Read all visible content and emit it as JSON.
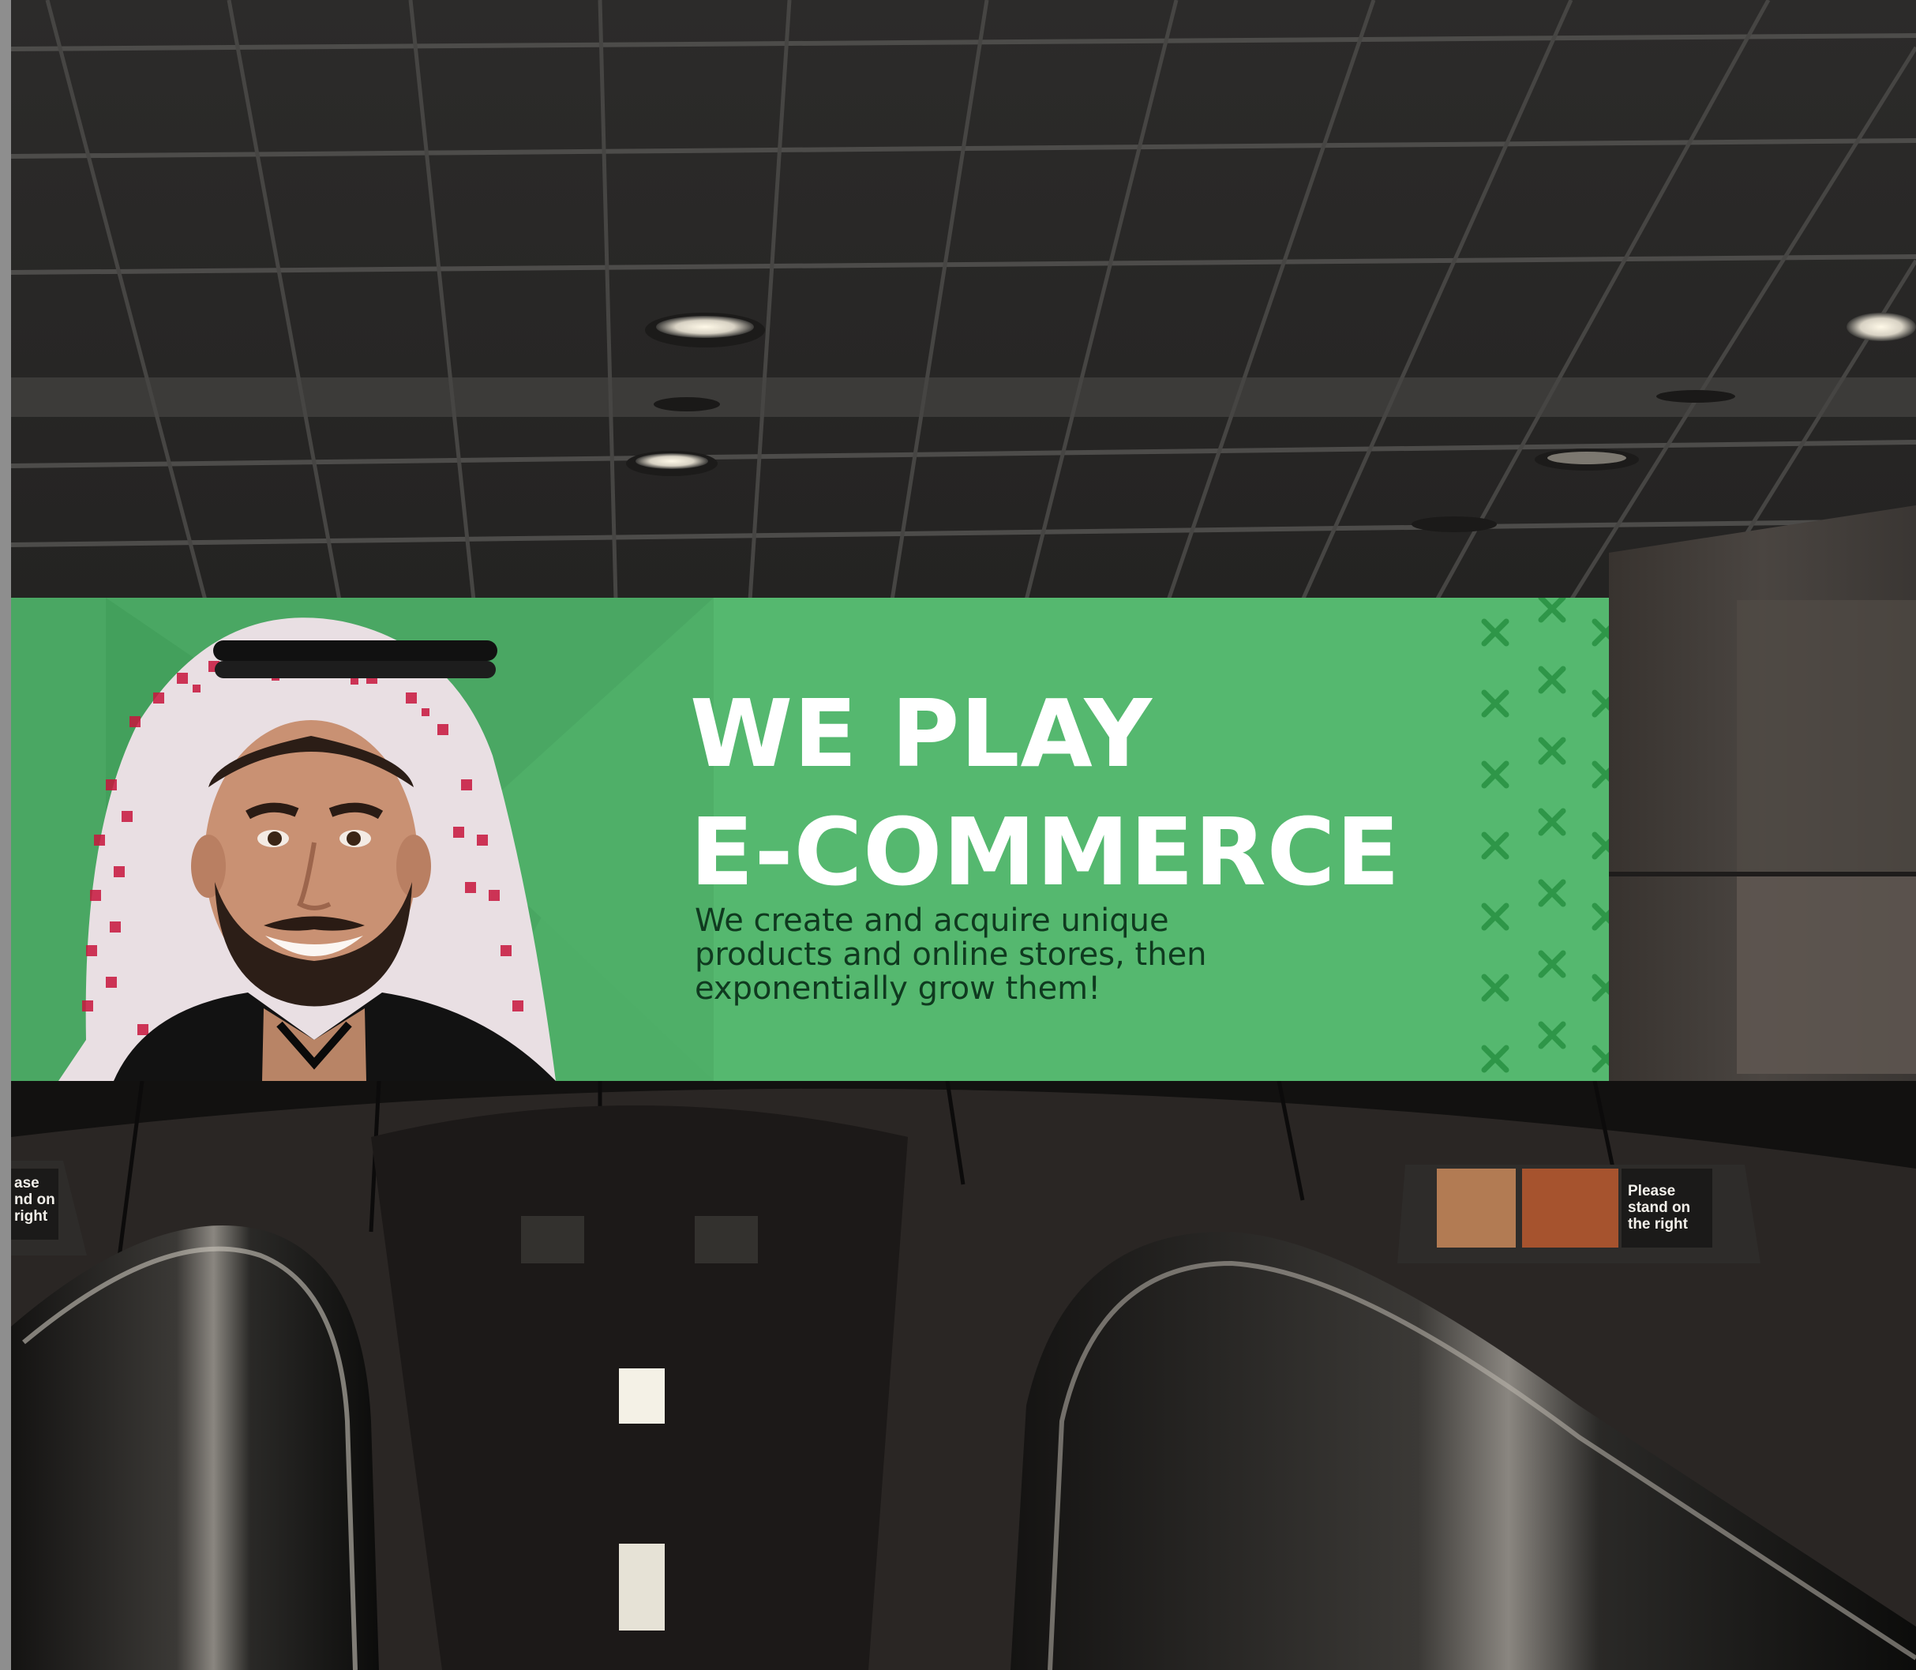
{
  "scene": {
    "description_colors": {
      "ceiling": "#2b2a29",
      "billboard_green": "#55b86f",
      "billboard_green_dark": "#4aa763",
      "pattern_green": "#2e9648",
      "headline_color": "#ffffff",
      "subcopy_color": "#0f3a1f"
    }
  },
  "billboard": {
    "headline": "WE PLAY\nE-COMMERCE",
    "subcopy": "We create and acquire unique products and online stores, then exponentially grow them!",
    "icons": [
      "person-portrait",
      "x-pattern-icon"
    ]
  },
  "signs": {
    "left_sign": "ase\nnd on\nright",
    "right_sign": "Please\nstand on\nthe right"
  }
}
